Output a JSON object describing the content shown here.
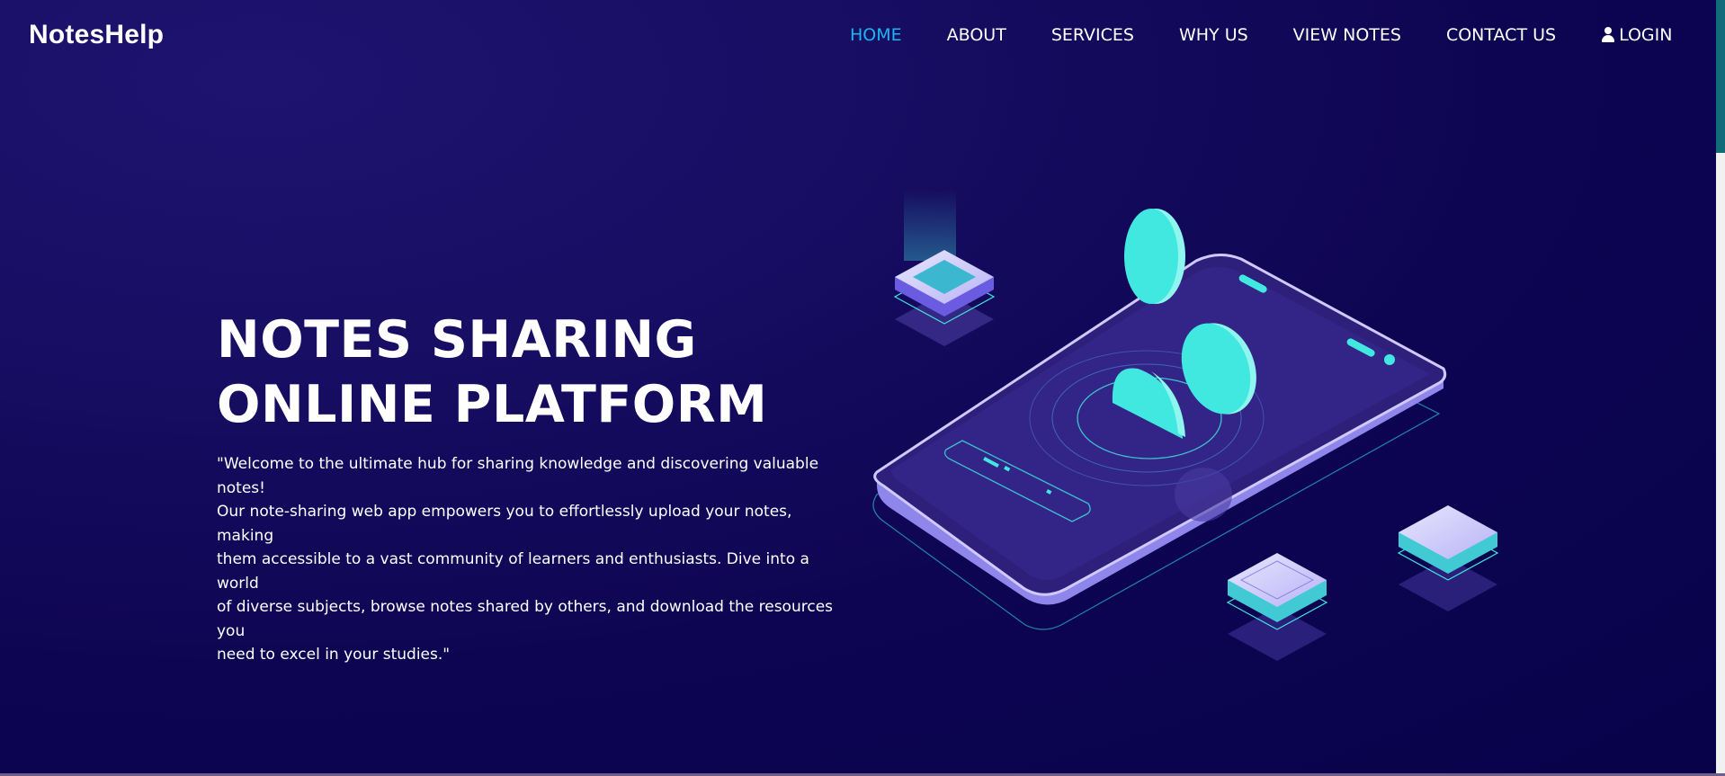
{
  "brand": {
    "name": "NotesHelp"
  },
  "nav": {
    "items": [
      {
        "label": "HOME",
        "active": true
      },
      {
        "label": "ABOUT",
        "active": false
      },
      {
        "label": "SERVICES",
        "active": false
      },
      {
        "label": "WHY US",
        "active": false
      },
      {
        "label": "VIEW NOTES",
        "active": false
      },
      {
        "label": "CONTACT US",
        "active": false
      }
    ],
    "login": {
      "label": "LOGIN",
      "icon": "user-icon"
    }
  },
  "hero": {
    "title_line1": "NOTES SHARING",
    "title_line2": "ONLINE PLATFORM",
    "description_lines": [
      "\"Welcome to the ultimate hub for sharing knowledge and discovering valuable notes!",
      "Our note-sharing web app empowers you to effortlessly upload your notes, making",
      "them accessible to a vast community of learners and enthusiasts. Dive into a world",
      "of diverse subjects, browse notes shared by others, and download the resources you",
      "need to excel in your studies.\""
    ]
  },
  "colors": {
    "background": "#0e0552",
    "accent": "#19b7f2",
    "teal": "#41e8e0",
    "lavender": "#9b92f0",
    "scroll_thumb": "#0f6c78"
  }
}
